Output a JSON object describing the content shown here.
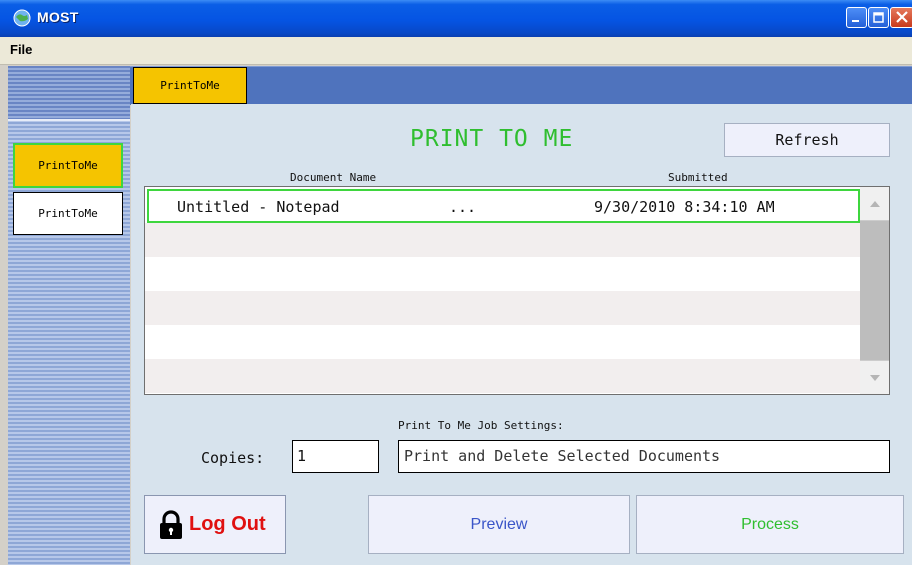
{
  "window": {
    "title": "MOST",
    "icon": "app-globe-icon",
    "controls": [
      "minimize-icon",
      "maximize-icon",
      "close-icon"
    ]
  },
  "menu": {
    "file": "File"
  },
  "sidebar": {
    "items": [
      {
        "label": "PrintToMe",
        "selected": true
      },
      {
        "label": "PrintToMe",
        "selected": false
      }
    ]
  },
  "tabs": [
    {
      "label": "PrintToMe"
    }
  ],
  "main": {
    "title": "PRINT TO ME",
    "refresh_label": "Refresh",
    "columns": {
      "document": "Document Name",
      "submitted": "Submitted"
    },
    "rows": [
      {
        "name": "Untitled - Notepad",
        "more": "...",
        "submitted": "9/30/2010 8:34:10 AM"
      }
    ],
    "settings_label": "Print To Me Job Settings:",
    "copies_label": "Copies:",
    "copies_value": "1",
    "job_setting": "Print and Delete Selected Documents"
  },
  "buttons": {
    "logout": "Log Out",
    "preview": "Preview",
    "process": "Process"
  },
  "colors": {
    "accent_green": "#2fbe2f",
    "tab_yellow": "#f5c400",
    "logout_red": "#e01010",
    "titlebar_blue": "#0554e3"
  }
}
